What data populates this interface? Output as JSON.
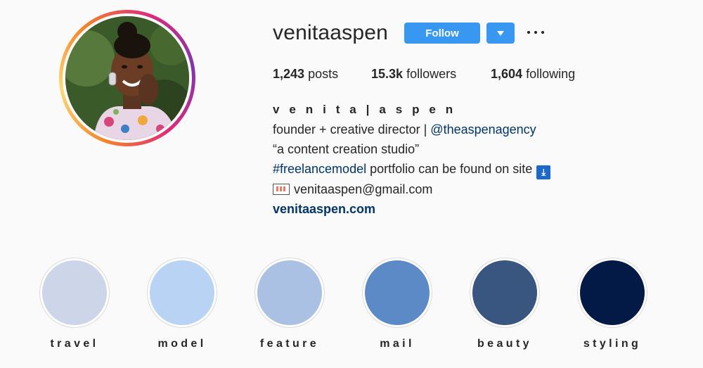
{
  "profile": {
    "username": "venitaaspen",
    "follow_label": "Follow"
  },
  "stats": {
    "posts_count": "1,243",
    "posts_label": "posts",
    "followers_count": "15.3k",
    "followers_label": "followers",
    "following_count": "1,604",
    "following_label": "following"
  },
  "bio": {
    "name": "v e n i t a | a s p e n",
    "line1_text": "founder + creative director | ",
    "line1_mention": "@theaspenagency",
    "line2": "“a content creation studio”",
    "line3_hashtag": "#freelancemodel",
    "line3_text": " portfolio can be found on site",
    "line3_emoji": "⤓",
    "email": "venitaaspen@gmail.com",
    "website": "venitaaspen.com"
  },
  "icons": {
    "dropdown": "chevron-down-icon",
    "more": "more-options-icon",
    "envelope": "envelope-icon",
    "down_arrow": "down-arrow-icon"
  },
  "highlights": [
    {
      "label": "travel",
      "color": "#cdd6e8"
    },
    {
      "label": "model",
      "color": "#b9d3f4"
    },
    {
      "label": "feature",
      "color": "#abc1e3"
    },
    {
      "label": "mail",
      "color": "#5b8ac6"
    },
    {
      "label": "beauty",
      "color": "#38567f"
    },
    {
      "label": "styling",
      "color": "#031a47"
    }
  ]
}
